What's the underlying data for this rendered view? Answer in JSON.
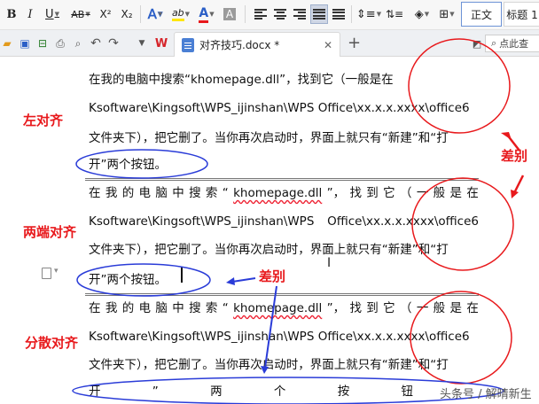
{
  "toolbar": {
    "bold": "B",
    "italic": "I",
    "underline": "U",
    "strike": "AB",
    "superscript": "X²",
    "subscript": "X₂",
    "text_effect": "A",
    "highlight": "ab",
    "font_color": "A",
    "char_shading": "A",
    "accent_color": "#2b5fc7",
    "font_color_value": "#e8191c",
    "highlight_color_value": "#ffe600"
  },
  "styles": {
    "normal": "正文",
    "heading1": "标题 1"
  },
  "tabbar": {
    "doc_tab_label": "对齐技巧.docx *",
    "new_tab": "+",
    "search_label": "点此查"
  },
  "document": {
    "left_block": {
      "line1": "在我的电脑中搜索“khomepage.dll”，找到它（一般是在",
      "line2": "Ksoftware\\Kingsoft\\WPS_ijinshan\\WPS Office\\xx.x.x.xxxx\\office6",
      "line3": "文件夹下），把它删了。当你再次启动时，界面上就只有“新建”和“打",
      "line4": "开”两个按钮。"
    },
    "justify_block": {
      "line1_chars": [
        "在",
        "我",
        "的",
        "电",
        "脑",
        "中",
        "搜",
        "索",
        "“",
        "khomepage.dll",
        "”，",
        "找",
        "到",
        "它",
        "（",
        "一",
        "般",
        "是",
        "在"
      ],
      "line2_parts": [
        "Ksoftware\\Kingsoft\\WPS_ijinshan\\WPS",
        "Office\\xx.x.x.xxxx\\office6"
      ],
      "line3": "文件夹下），把它删了。当你再次启动时，界面上就只有“新建”和“打",
      "line4": "开”两个按钮。"
    },
    "distributed_block": {
      "line1_chars": [
        "在",
        "我",
        "的",
        "电",
        "脑",
        "中",
        "搜",
        "索",
        "“",
        "khomepage.dll",
        "”，",
        "找",
        "到",
        "它",
        "（",
        "一",
        "般",
        "是",
        "在"
      ],
      "line2": "Ksoftware\\Kingsoft\\WPS_ijinshan\\WPS Office\\xx.x.x.xxxx\\office6",
      "line3": "文件夹下），把它删了。当你再次启动时，界面上就只有“新建”和“打",
      "line4_chars": [
        "开",
        "”",
        "两",
        "个",
        "按",
        "钮"
      ]
    }
  },
  "annotations": {
    "left_align": "左对齐",
    "justify": "两端对齐",
    "distributed": "分散对齐",
    "difference_1": "差别",
    "difference_2": "差别",
    "annotation_color": "#e8191c",
    "arrow_color": "#2a3cd8"
  },
  "watermark": "头条号 / 解晴新生"
}
